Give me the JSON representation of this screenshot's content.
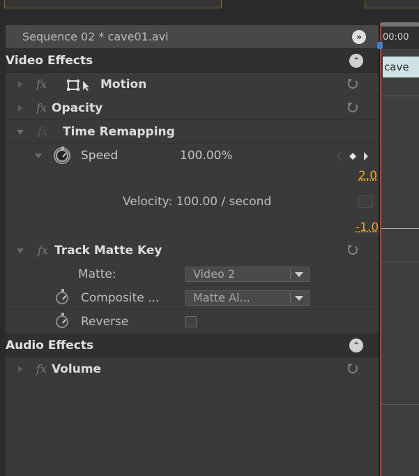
{
  "header": {
    "sequence_title": "Sequence 02 * cave01.avi",
    "menu_icon_glyph": "»"
  },
  "sections": {
    "video": {
      "title": "Video Effects",
      "collapse_glyph": "⌃"
    },
    "audio": {
      "title": "Audio Effects",
      "collapse_glyph": "⌃"
    }
  },
  "effects": {
    "motion": {
      "label": "Motion"
    },
    "opacity": {
      "label": "Opacity"
    },
    "time_remapping": {
      "label": "Time Remapping",
      "speed_label": "Speed",
      "speed_value": "100.00%",
      "graph_max": "2.0",
      "velocity_text": "Velocity: 100.00 / second",
      "graph_min": "-1.0"
    },
    "track_matte": {
      "label": "Track Matte Key",
      "matte_label": "Matte:",
      "matte_value": "Video 2",
      "composite_label": "Composite ...",
      "composite_value": "Matte Al...",
      "reverse_label": "Reverse"
    },
    "volume": {
      "label": "Volume"
    }
  },
  "fx_badge": "fx",
  "timeline": {
    "timecode": "00:00",
    "clip_name": "cave"
  },
  "colors": {
    "accent_yellow": "#e5a52a",
    "playhead_red": "#c83838",
    "clip_cyan": "#cfe3e6"
  }
}
